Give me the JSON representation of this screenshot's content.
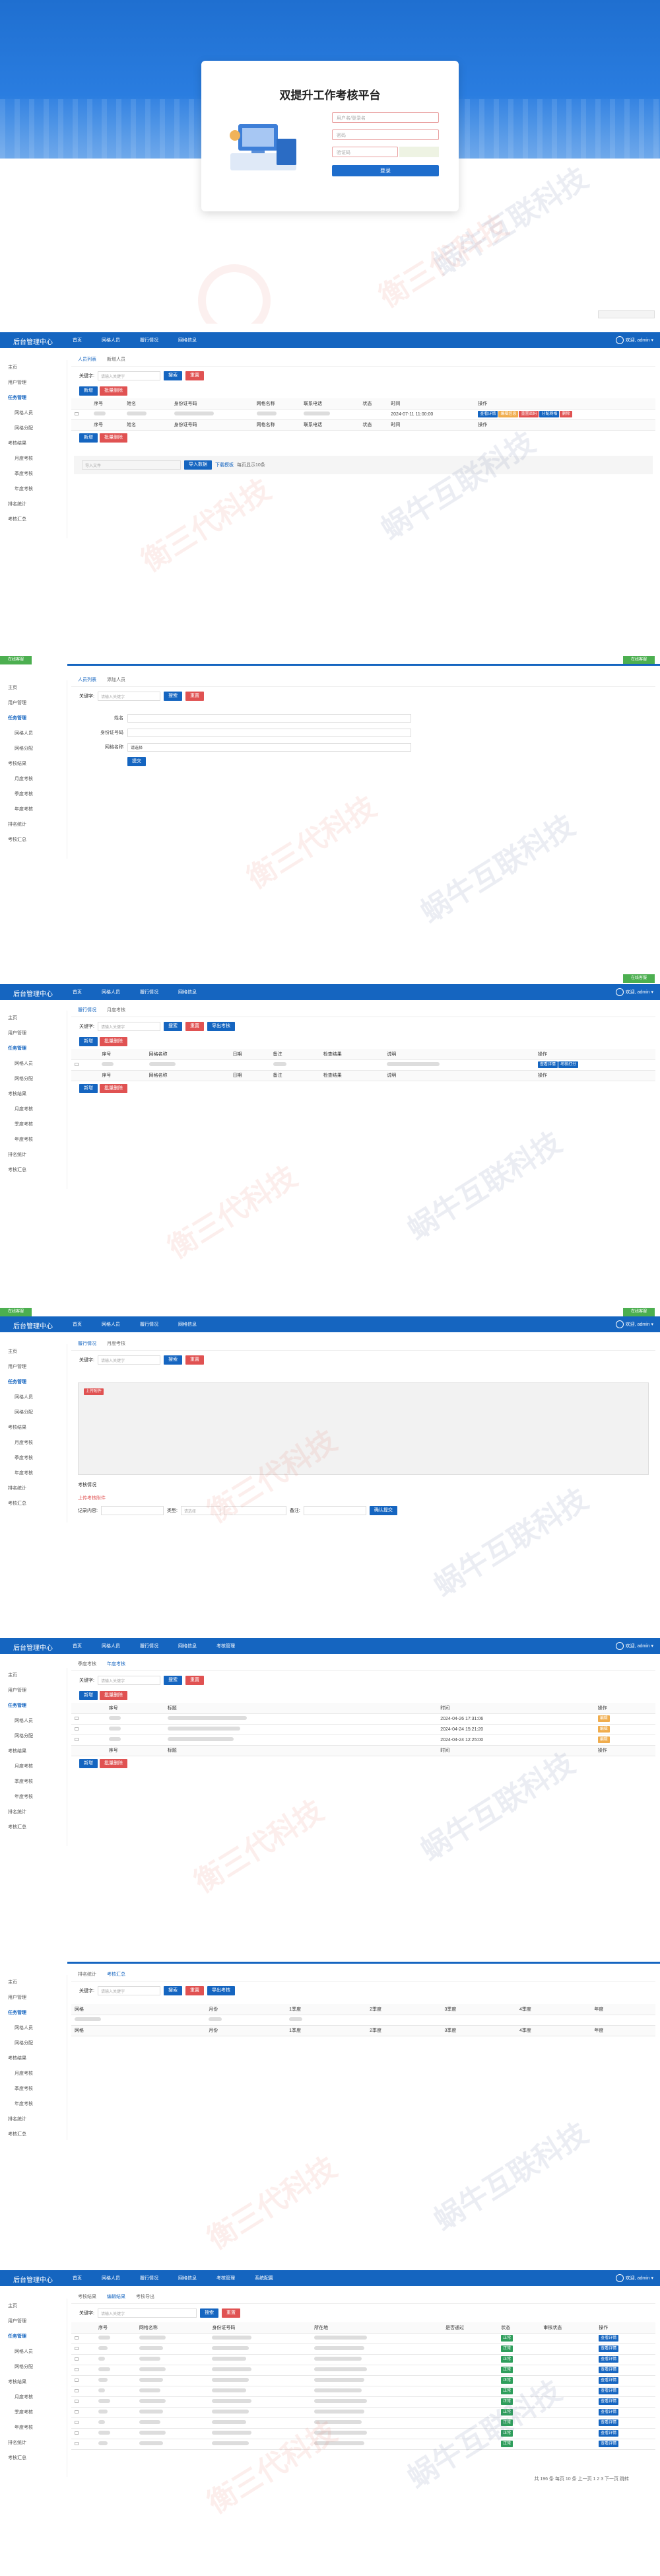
{
  "login": {
    "title": "双提升工作考核平台",
    "user_placeholder": "用户名/登录名",
    "pwd_placeholder": "密码",
    "code_placeholder": "验证码",
    "button": "登录"
  },
  "app": {
    "brand": "后台管理中心",
    "nav": [
      "首页",
      "网格人员",
      "履行情况",
      "网格信息",
      "考核管理",
      "系统配置"
    ],
    "user": "欢迎, admin ▾"
  },
  "sidebar": [
    "主页",
    "用户管理",
    "任务管理",
    "网格人员",
    "网格分配",
    "考核结果",
    "月度考核",
    "季度考核",
    "年度考核",
    "排名统计",
    "考核汇总"
  ],
  "watermark": {
    "a": "衡三代科技",
    "b": "蜗牛互联科技"
  },
  "s1": {
    "tabs": [
      "人员列表",
      "新增人员"
    ],
    "search_label": "关键字:",
    "search_ph": "请输入关键字",
    "search": "搜索",
    "reset": "重置",
    "add": "新增",
    "del": "批量删除",
    "cols": [
      "",
      "序号",
      "姓名",
      "身份证号码",
      "网格名称",
      "联系电话",
      "状态",
      "时间",
      "操作"
    ],
    "row_time": "2024-07-11 11:00:00",
    "row_ops": [
      "查看详情",
      "编辑信息",
      "重置密码",
      "分配网格",
      "删除"
    ],
    "import_label": "导入文件",
    "import_btn": "导入数据",
    "download": "下载模板",
    "page_info": "每页显示10条"
  },
  "s2": {
    "tabs": [
      "人员列表",
      "添加人员"
    ],
    "fields": [
      "姓名",
      "身份证号码",
      "网格名称"
    ],
    "select": "请选择",
    "submit": "提交"
  },
  "s3": {
    "tabs": [
      "履行情况",
      "月度考核"
    ],
    "cols": [
      "",
      "序号",
      "网格名称",
      "日期",
      "备注",
      "检查结果",
      "说明",
      "操作"
    ],
    "ops": [
      "查看详情",
      "考核打分"
    ],
    "export": "导出考核"
  },
  "s4": {
    "tabs": [
      "履行情况",
      "月度考核"
    ],
    "upload": "上传附件",
    "section": "考核情况",
    "row_label": "记录内容:",
    "type_label": "类型:",
    "type_val": "请选择",
    "attach": "上传考核附件",
    "note_label": "备注:",
    "confirm": "确认提交"
  },
  "s5": {
    "tabs": [
      "季度考核",
      "年度考核"
    ],
    "cols": [
      "",
      "序号",
      "标题",
      "时间",
      "操作"
    ],
    "rows": [
      {
        "time": "2024-04-26 17:31:06",
        "op": "编辑"
      },
      {
        "time": "2024-04-24 15:21:20",
        "op": "编辑"
      },
      {
        "time": "2024-04-24 12:25:00",
        "op": "编辑"
      }
    ]
  },
  "s6": {
    "tabs": [
      "排名统计",
      "考核汇总"
    ],
    "cols": [
      "网格",
      "月份",
      "1季度",
      "2季度",
      "3季度",
      "4季度",
      "年度"
    ]
  },
  "s7": {
    "tabs": [
      "考核结果",
      "编辑结果",
      "考核导出"
    ],
    "cols": [
      "",
      "序号",
      "网格名称",
      "身份证号码",
      "所在地",
      "是否通过",
      "状态",
      "审核状态",
      "操作"
    ],
    "status": "正常",
    "op": "查看详情",
    "footer": "共 196 条 每页 10 条 上一页 1 2 3 下一页 跳转"
  },
  "corner": "在线客服"
}
